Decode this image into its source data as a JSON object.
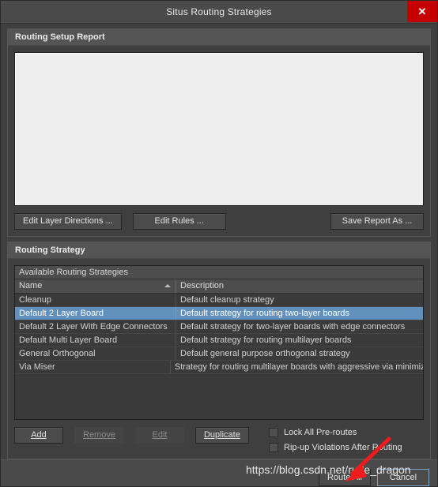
{
  "window": {
    "title": "Situs Routing Strategies",
    "close_icon": "close-icon",
    "close_label": "✕"
  },
  "report_panel": {
    "header": "Routing Setup Report",
    "content": "",
    "buttons": {
      "edit_layer_directions": "Edit Layer Directions ...",
      "edit_rules": "Edit Rules ...",
      "save_report_as": "Save Report As ..."
    }
  },
  "strategy_panel": {
    "header": "Routing Strategy",
    "table": {
      "caption": "Available Routing Strategies",
      "columns": [
        "Name",
        "Description"
      ],
      "sort_column": "Name",
      "sort_direction": "ascending",
      "rows": [
        {
          "name": "Cleanup",
          "description": "Default cleanup strategy",
          "selected": false
        },
        {
          "name": "Default 2 Layer Board",
          "description": "Default strategy for routing two-layer boards",
          "selected": true
        },
        {
          "name": "Default 2 Layer With Edge Connectors",
          "description": "Default strategy for two-layer boards with edge connectors",
          "selected": false
        },
        {
          "name": "Default Multi Layer Board",
          "description": "Default strategy for routing multilayer boards",
          "selected": false
        },
        {
          "name": "General Orthogonal",
          "description": "Default general purpose orthogonal strategy",
          "selected": false
        },
        {
          "name": "Via Miser",
          "description": "Strategy for routing multilayer boards with aggressive via minimizat",
          "selected": false
        }
      ]
    },
    "buttons": {
      "add": "Add",
      "add_mnemonic": "A",
      "remove": "Remove",
      "remove_mnemonic": "R",
      "edit": "Edit",
      "edit_mnemonic": "E",
      "duplicate": "Duplicate",
      "duplicate_mnemonic": "D"
    },
    "button_states": {
      "add": "enabled",
      "remove": "disabled",
      "edit": "disabled",
      "duplicate": "enabled"
    },
    "checkboxes": [
      {
        "label": "Lock All Pre-routes",
        "checked": false
      },
      {
        "label": "Rip-up Violations After Routing",
        "checked": false
      }
    ]
  },
  "footer": {
    "route_all": "Route All",
    "cancel": "Cancel"
  },
  "annotations": {
    "watermark": "https://blog.csdn.net/rude_dragon",
    "arrow_color": "#ee1c1c",
    "arrow_target": "route-all-button"
  },
  "colors": {
    "dialog_bg": "#3f3f3f",
    "titlebar_bg": "#4a4a4a",
    "close_red": "#c40000",
    "panel_header_bg": "#545454",
    "report_white": "#eeeeee",
    "selection_blue": "#6090bb",
    "focus_outline": "#7aa7d0"
  }
}
